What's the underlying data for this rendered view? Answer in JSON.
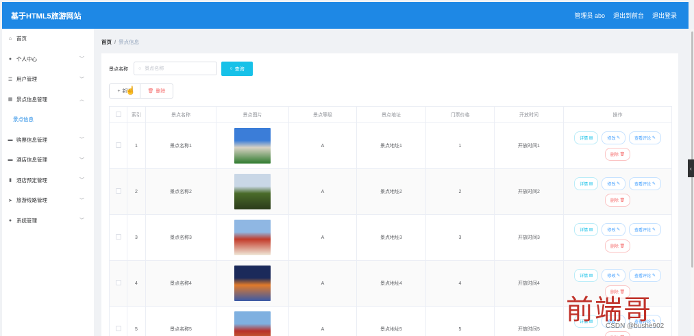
{
  "header": {
    "title": "基于HTML5旅游网站",
    "admin_label": "管理员 abo",
    "goto_front": "退出到前台",
    "logout": "退出登录"
  },
  "sidebar": {
    "items": [
      {
        "icon": "home-icon",
        "label": "首页",
        "has_chevron": false
      },
      {
        "icon": "user-icon",
        "label": "个人中心",
        "has_chevron": true
      },
      {
        "icon": "menu-icon",
        "label": "用户管理",
        "has_chevron": true
      },
      {
        "icon": "grid-icon",
        "label": "景点信息管理",
        "has_chevron": true,
        "expanded": true
      },
      {
        "icon": "",
        "label": "景点信息",
        "sub": true,
        "active": true
      },
      {
        "icon": "ticket-icon",
        "label": "购票信息管理",
        "has_chevron": true
      },
      {
        "icon": "hotel-icon",
        "label": "酒店信息管理",
        "has_chevron": true
      },
      {
        "icon": "chart-icon",
        "label": "酒店预定管理",
        "has_chevron": true
      },
      {
        "icon": "send-icon",
        "label": "旅游线路管理",
        "has_chevron": true
      },
      {
        "icon": "user-icon",
        "label": "系统管理",
        "has_chevron": true
      }
    ]
  },
  "breadcrumb": {
    "home": "首页",
    "sep": "/",
    "current": "景点信息"
  },
  "search": {
    "label": "景点名称",
    "placeholder": "景点名称",
    "button": "查询"
  },
  "toolbar": {
    "add": "新增",
    "delete": "删除"
  },
  "table": {
    "headers": [
      "",
      "索引",
      "景点名称",
      "景点图片",
      "景点等级",
      "景点地址",
      "门票价格",
      "开放时间",
      "操作"
    ],
    "rows": [
      {
        "index": "1",
        "name": "景点名称1",
        "level": "A",
        "address": "景点地址1",
        "price": "1",
        "open": "开放时间1",
        "img_colors": [
          "#3b7dd8",
          "#d8d2c4",
          "#2e7a2e"
        ]
      },
      {
        "index": "2",
        "name": "景点名称2",
        "level": "A",
        "address": "景点地址2",
        "price": "2",
        "open": "开放时间2",
        "img_colors": [
          "#c9d7e6",
          "#4a6b2a",
          "#2b3b1a"
        ]
      },
      {
        "index": "3",
        "name": "景点名称3",
        "level": "A",
        "address": "景点地址3",
        "price": "3",
        "open": "开放时间3",
        "img_colors": [
          "#8fb7e3",
          "#c23b2a",
          "#f0e8d8"
        ]
      },
      {
        "index": "4",
        "name": "景点名称4",
        "level": "A",
        "address": "景点地址4",
        "price": "4",
        "open": "开放时间4",
        "img_colors": [
          "#1b2a5a",
          "#e07a2a",
          "#3a5aa8"
        ]
      },
      {
        "index": "5",
        "name": "景点名称5",
        "level": "A",
        "address": "景点地址5",
        "price": "5",
        "open": "开放时间5",
        "img_colors": [
          "#7fb0e0",
          "#b8302a",
          "#d4a040"
        ]
      }
    ],
    "ops": {
      "detail": "详情",
      "edit": "修改",
      "review": "查看评论",
      "remove": "删除"
    }
  },
  "watermark": {
    "big": "前端哥",
    "small": "CSDN @bushe902"
  },
  "colors": {
    "primary": "#1e88e5",
    "info": "#17c1e8",
    "danger": "#f56c6c"
  }
}
